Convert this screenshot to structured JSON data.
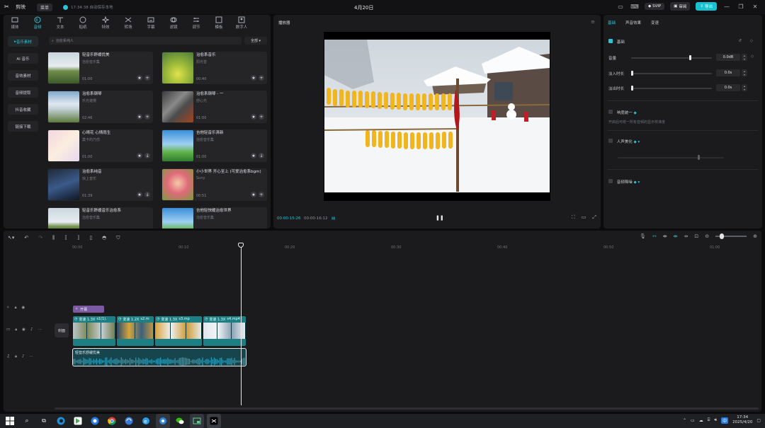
{
  "titlebar": {
    "logo": "剪映",
    "menu": "菜单",
    "save_status": "17:34:38 自动保存本地",
    "project_title": "4月20日",
    "svip": "SVIP",
    "feedback": "审阅",
    "export": "导出"
  },
  "media": {
    "tabs": [
      "媒体",
      "音频",
      "文本",
      "贴纸",
      "特效",
      "转场",
      "字幕",
      "滤镜",
      "调节",
      "模板",
      "数字人"
    ],
    "active_tab": "音频",
    "categories": [
      "音乐素材",
      "AI 音乐",
      "音效素材",
      "音频提取",
      "抖音收藏",
      "链接下载"
    ],
    "search_placeholder": "治愈系纯人",
    "filter": "全部",
    "cards": [
      {
        "title": "轻音乐舒缓优美",
        "sub": "治愈音乐集",
        "dur": "01:00"
      },
      {
        "title": "治愈系音乐",
        "sub": "阳光音",
        "dur": "00:40"
      },
      {
        "title": "治愈系钢琴",
        "sub": "乐光谱慢",
        "dur": "02:46"
      },
      {
        "title": "治愈系钢琴 - 一",
        "sub": "舒心光",
        "dur": "01:00"
      },
      {
        "title": "心晴花 心情雨生",
        "sub": "莫卡的乃仿",
        "dur": "01:00"
      },
      {
        "title": "吉他轻音乐清新",
        "sub": "治愈音乐集",
        "dur": "01:00"
      },
      {
        "title": "治愈系纯音",
        "sub": "快上音乐",
        "dur": "01:39"
      },
      {
        "title": "小小世界 开心至上 (可爱治愈系bgm)",
        "sub": "Suny",
        "dur": "00:51"
      },
      {
        "title": "轻音乐舒缓音乐治愈系",
        "sub": "治愈音乐集",
        "dur": ""
      },
      {
        "title": "吉他轻快暖治愈世界",
        "sub": "治愈音乐集",
        "dur": ""
      }
    ]
  },
  "player": {
    "title": "播放器",
    "current_time": "00:00:15:26",
    "total_time": "00:00:16:12"
  },
  "props": {
    "tabs": [
      "基础",
      "声音效果",
      "变速"
    ],
    "basic_label": "基础",
    "volume_label": "音量",
    "volume_value": "0.0dB",
    "fade_in_label": "淡入时长",
    "fade_in_value": "0.0s",
    "fade_out_label": "淡出时长",
    "fade_out_value": "0.0s",
    "loudness_label": "响度统一",
    "loudness_desc": "开启后可统一所有音频的显示校准度",
    "voice_label": "人声美化",
    "denoise_label": "音频降噪"
  },
  "timeline": {
    "ruler": [
      "00:00",
      "00:10",
      "00:20",
      "00:30",
      "00:40",
      "00:50",
      "01:00"
    ],
    "cover_label": "封面",
    "fx_clip": "开幕",
    "video_clips": [
      {
        "speed": "变速 1.3X",
        "name": "s1(1)."
      },
      {
        "speed": "变速 1.2X",
        "name": "s2.m"
      },
      {
        "speed": "变速 1.3X",
        "name": "s3.mp"
      },
      {
        "speed": "变速 1.3X",
        "name": "s4.mp4"
      }
    ],
    "audio_clip": "轻音乐舒缓优美"
  },
  "taskbar": {
    "time": "17:34",
    "date": "2025/4/20"
  },
  "colors": {
    "accent": "#27c6d8",
    "panel": "#1b1b1d",
    "background": "#0b0b0c"
  }
}
